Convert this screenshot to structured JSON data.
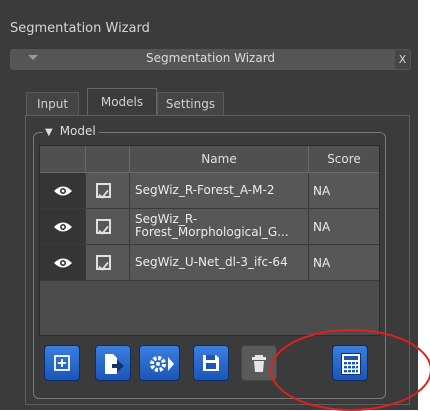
{
  "window": {
    "title": "Segmentation Wizard"
  },
  "collapsible": {
    "title": "Segmentation Wizard",
    "close_label": "X"
  },
  "tabs": [
    {
      "label": "Input",
      "active": false
    },
    {
      "label": "Models",
      "active": true
    },
    {
      "label": "Settings",
      "active": false
    }
  ],
  "model_group": {
    "legend": "Model",
    "columns": [
      "",
      "",
      "Name",
      "Score"
    ],
    "rows": [
      {
        "visible": true,
        "checked": true,
        "name": "SegWiz_R-Forest_A-M-2",
        "score": "NA"
      },
      {
        "visible": true,
        "checked": true,
        "name": "SegWiz_R-\nForest_Morphological_G...",
        "score": "NA"
      },
      {
        "visible": true,
        "checked": true,
        "name": "SegWiz_U-Net_dl-3_ifc-64",
        "score": "NA"
      }
    ]
  },
  "toolbar": {
    "buttons": [
      {
        "icon": "add-model-icon",
        "enabled": true
      },
      {
        "icon": "export-model-icon",
        "enabled": true
      },
      {
        "icon": "model-settings-icon",
        "enabled": true
      },
      {
        "icon": "save-icon",
        "enabled": true
      },
      {
        "icon": "trash-icon",
        "enabled": false
      },
      {
        "icon": "calculator-icon",
        "enabled": true
      }
    ]
  },
  "annotation": {
    "color": "#e02020"
  },
  "colors": {
    "accent": "#2a6ad0",
    "panel": "#3b3b3b",
    "annotation": "#e02020"
  }
}
